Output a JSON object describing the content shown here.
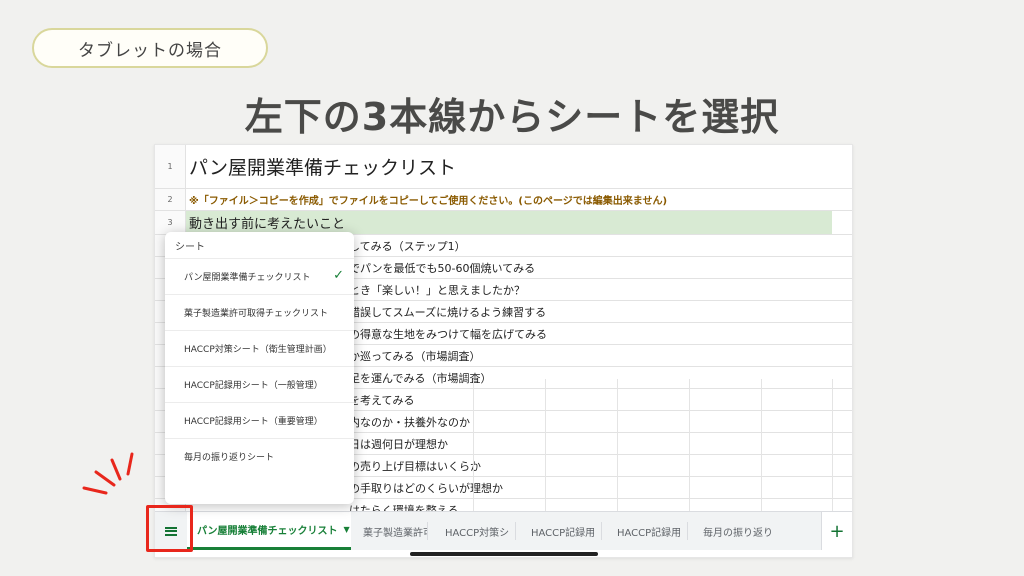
{
  "badge": "タブレットの場合",
  "headline": "左下の3本線からシートを選択",
  "sheet": {
    "rows": [
      {
        "num": "1",
        "text": "パン屋開業準備チェックリスト"
      },
      {
        "num": "2",
        "text": "※「ファイル＞コピーを作成」でファイルをコピーしてご使用ください。(このページでは編集出来ません)"
      },
      {
        "num": "3",
        "text": "動き出す前に考えたいこと"
      }
    ],
    "items": [
      "してみる（ステップ1）",
      "でパンを最低でも50-60個焼いてみる",
      "とき「楽しい！」と思えましたか？",
      "錯誤してスムーズに焼けるよう練習する",
      "の得意な生地をみつけて幅を広げてみる",
      "か巡ってみる（市場調査）",
      "足を運んでみる（市場調査）",
      "を考えてみる",
      "内なのか・扶養外なのか",
      "日は週何日が理想か",
      "の売り上げ目標はいくらか",
      "の手取りはどのくらいが理想か",
      "はたらく環境を整える"
    ]
  },
  "popup": {
    "title": "シート",
    "items": [
      "パン屋開業準備チェックリスト",
      "菓子製造業許可取得チェックリスト",
      "HACCP対策シート（衛生管理計画）",
      "HACCP記録用シート（一般管理）",
      "HACCP記録用シート（重要管理）",
      "毎月の振り返りシート"
    ],
    "check": "✓"
  },
  "tabs": {
    "active": "パン屋開業準備チェックリスト",
    "caret": "▼",
    "others": [
      "菓子製造業許可",
      "HACCP対策シ",
      "HACCP記録用",
      "HACCP記録用",
      "毎月の振り返り"
    ],
    "add": "+"
  },
  "colors": {
    "accent_green": "#188038",
    "highlight_red": "#e8271c",
    "header_band": "#d8ead3"
  }
}
